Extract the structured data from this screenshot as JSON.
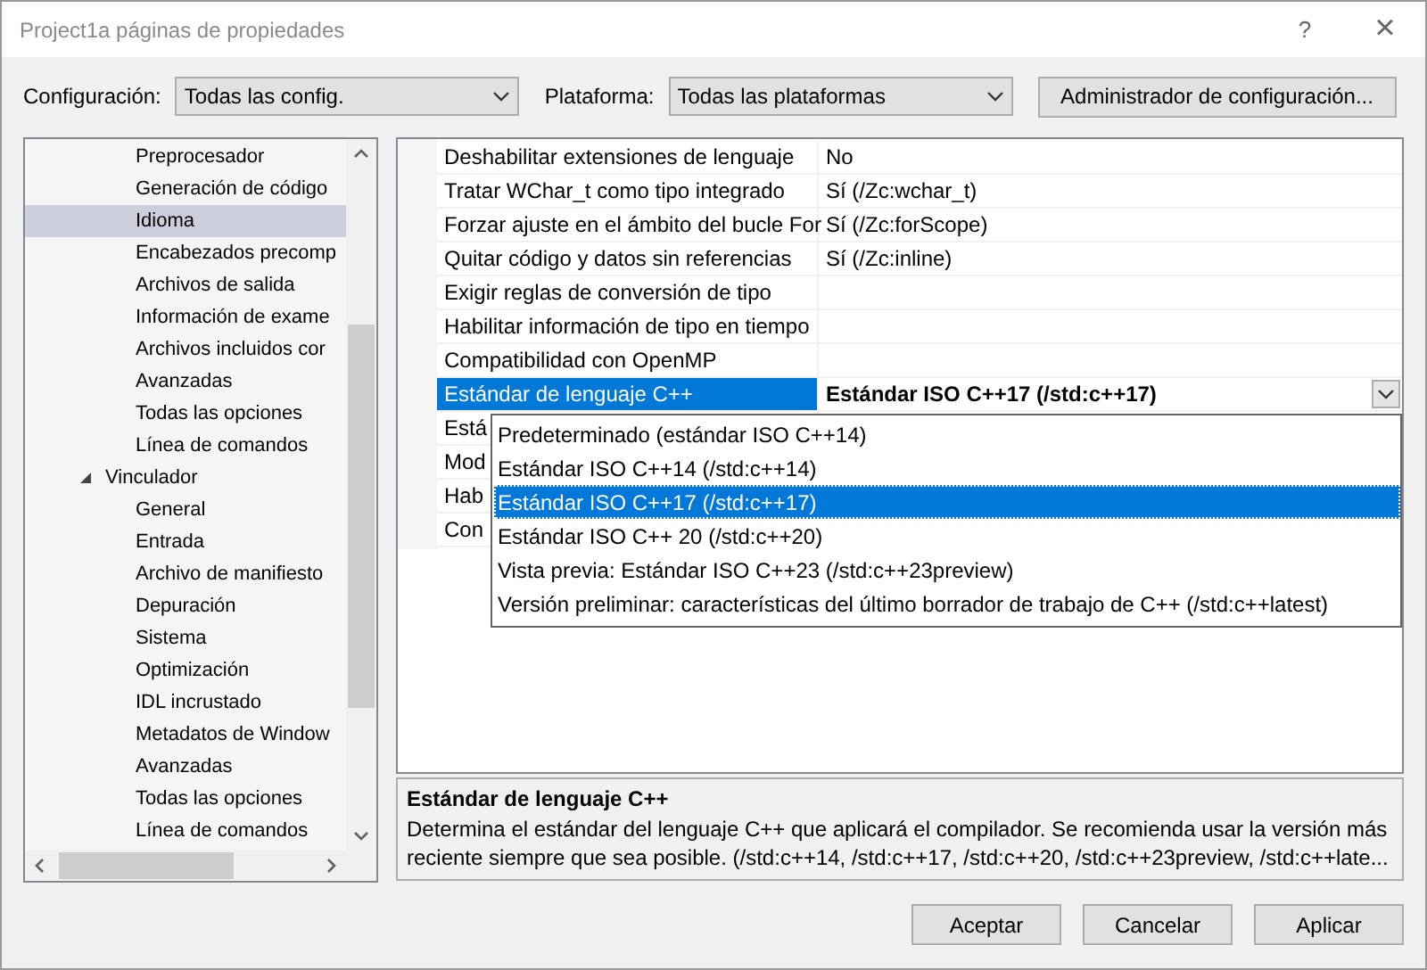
{
  "window": {
    "title": "Project1a páginas de propiedades",
    "help": "?",
    "close": "×"
  },
  "toolbar": {
    "configuration_label": "Configuración:",
    "configuration": "Todas las config.",
    "platform_label": "Plataforma:",
    "platform": "Todas las plataformas",
    "manager_button": "Administrador de configuración..."
  },
  "tree": {
    "continued_children": [
      {
        "label": "Preprocesador",
        "selected": false
      },
      {
        "label": "Generación de código",
        "selected": false
      },
      {
        "label": "Idioma",
        "selected": true
      },
      {
        "label": "Encabezados precomp",
        "selected": false
      },
      {
        "label": "Archivos de salida",
        "selected": false
      },
      {
        "label": "Información de exame",
        "selected": false
      },
      {
        "label": "Archivos incluidos cor",
        "selected": false
      },
      {
        "label": "Avanzadas",
        "selected": false
      },
      {
        "label": "Todas las opciones",
        "selected": false
      },
      {
        "label": "Línea de comandos",
        "selected": false
      }
    ],
    "items": [
      {
        "label": "Vinculador",
        "selected": false,
        "expanded": true,
        "children": [
          {
            "label": "General",
            "selected": false
          },
          {
            "label": "Entrada",
            "selected": false
          },
          {
            "label": "Archivo de manifiesto",
            "selected": false
          },
          {
            "label": "Depuración",
            "selected": false
          },
          {
            "label": "Sistema",
            "selected": false
          },
          {
            "label": "Optimización",
            "selected": false
          },
          {
            "label": "IDL incrustado",
            "selected": false
          },
          {
            "label": "Metadatos de Window",
            "selected": false
          },
          {
            "label": "Avanzadas",
            "selected": false
          },
          {
            "label": "Todas las opciones",
            "selected": false
          },
          {
            "label": "Línea de comandos",
            "selected": false
          }
        ]
      }
    ]
  },
  "properties": [
    {
      "name": "Deshabilitar extensiones de lenguaje",
      "value": "No",
      "selected": false
    },
    {
      "name": "Tratar WChar_t como tipo integrado",
      "value": "Sí (/Zc:wchar_t)",
      "selected": false
    },
    {
      "name": "Forzar ajuste en el ámbito del bucle For",
      "value": "Sí (/Zc:forScope)",
      "selected": false
    },
    {
      "name": "Quitar código y datos sin referencias",
      "value": "Sí (/Zc:inline)",
      "selected": false
    },
    {
      "name": "Exigir reglas de conversión de tipo",
      "selected": false
    },
    {
      "name": "Habilitar información de tipo en tiempo",
      "selected": false
    },
    {
      "name": "Compatibilidad con OpenMP",
      "selected": false
    },
    {
      "name": "Estándar de lenguaje C++",
      "value": "Estándar ISO C++17 (/std:c++17)",
      "selected": true
    },
    {
      "name": "Está",
      "selected": false
    },
    {
      "name": "Mod",
      "selected": false
    },
    {
      "name": "Hab",
      "selected": false
    },
    {
      "name": "Con",
      "selected": false
    }
  ],
  "dropdown_options": [
    {
      "label": "Predeterminado (estándar ISO C++14)",
      "selected": false
    },
    {
      "label": "Estándar ISO C++14 (/std:c++14)",
      "selected": false
    },
    {
      "label": "Estándar ISO C++17 (/std:c++17)",
      "selected": true
    },
    {
      "label": "Estándar ISO C++ 20 (/std:c++20)",
      "selected": false
    },
    {
      "label": "Vista previa: Estándar ISO C++23 (/std:c++23preview)",
      "selected": false
    },
    {
      "label": "Versión preliminar: características del último borrador de trabajo de C++ (/std:c++latest)",
      "selected": false
    }
  ],
  "description": {
    "title": "Estándar de lenguaje C++",
    "text": "Determina el estándar del lenguaje C++ que aplicará el compilador. Se recomienda usar la versión más reciente siempre que sea posible. (/std:c++14, /std:c++17, /std:c++20, /std:c++23preview, /std:c++late..."
  },
  "buttons": [
    "Aceptar",
    "Cancelar",
    "Aplicar"
  ]
}
